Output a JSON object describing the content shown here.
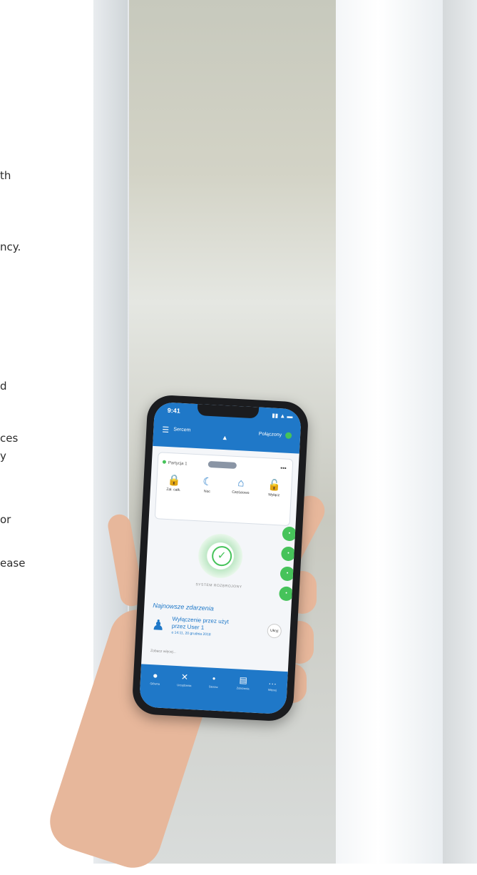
{
  "text_fragments": [
    "th",
    "ncy.",
    "d",
    "ces",
    "y",
    "or",
    "ease"
  ],
  "phone": {
    "time": "9:41",
    "status_icons": "▮▮ ▲ ▬",
    "menu_icon": "menu-icon",
    "title": "Sercem",
    "connection_label": "Połączony",
    "partition_label": "Partycja 1",
    "pill_label": "",
    "modes": [
      {
        "icon": "🔒",
        "label": "Zał. całk."
      },
      {
        "icon": "☾",
        "label": "Noc"
      },
      {
        "icon": "⌂",
        "label": "Częściowo"
      },
      {
        "icon": "🔓",
        "label": "Wyłącz"
      }
    ],
    "system_status": "SYSTEM ROZBROJONY",
    "events_title": "Najnowsze zdarzenia",
    "event": {
      "line1": "Wyłączenie przez użyt",
      "line2": "przez User 1",
      "line3": "o 14:11, 20 grudnia 2018"
    },
    "hide_label": "Ukryj",
    "more_link": "Zobacz więcej...",
    "tabs": [
      {
        "icon": "●",
        "label": "Główna"
      },
      {
        "icon": "✕",
        "label": "Urządzenia"
      },
      {
        "icon": "•",
        "label": "Sterow."
      },
      {
        "icon": "▤",
        "label": "Zdarzenia"
      },
      {
        "icon": "…",
        "label": "Więcej"
      }
    ],
    "colors": {
      "primary": "#1f78c8",
      "ok": "#46c35a"
    }
  }
}
